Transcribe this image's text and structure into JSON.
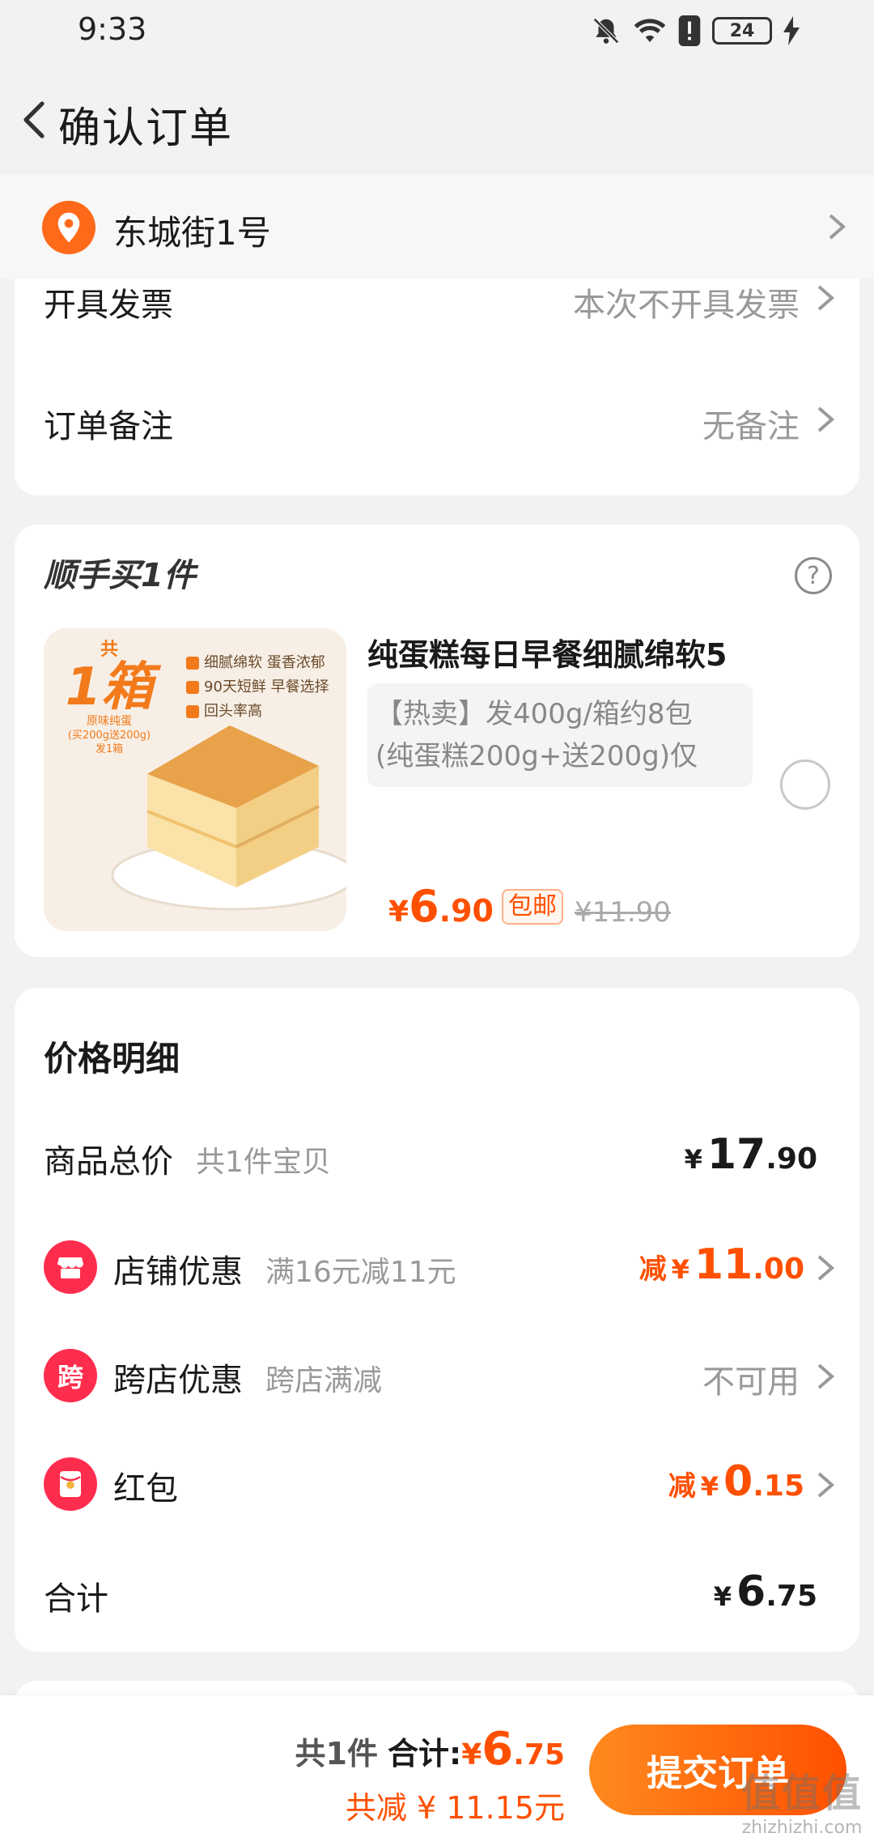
{
  "status_bar": {
    "time": "9:33",
    "battery": "24"
  },
  "header": {
    "title": "确认订单"
  },
  "address": {
    "text": "东城街1号"
  },
  "invoice": {
    "label": "开具发票",
    "value": "本次不开具发票"
  },
  "note": {
    "label": "订单备注",
    "value": "无备注"
  },
  "addon": {
    "section_title": "顺手买1件",
    "help": "?",
    "image": {
      "badge_top": "共",
      "badge_main": "1箱",
      "badge_sub1": "原味纯蛋",
      "badge_sub2": "(买200g送200g)",
      "badge_sub3": "发1箱",
      "features": [
        "细腻绵软 蛋香浓郁",
        "90天短鲜 早餐选择",
        "回头率高"
      ]
    },
    "title": "纯蛋糕每日早餐细腻绵软5",
    "desc_line1": "【热卖】发400g/箱约8包",
    "desc_line2": "(纯蛋糕200g+送200g)仅",
    "price_yen": "¥",
    "price_int": "6",
    "price_dec": ".90",
    "free_shipping": "包邮",
    "old_price": "¥11.90"
  },
  "price_detail": {
    "title": "价格明细",
    "goods_total": {
      "label": "商品总价",
      "sub": "共1件宝贝",
      "yen": "¥",
      "int": "17",
      "dec": ".90"
    },
    "shop_discount": {
      "label": "店铺优惠",
      "sub": "满16元减11元",
      "pre": "减",
      "yen": "¥",
      "int": "11",
      "dec": ".00"
    },
    "cross_discount": {
      "label": "跨店优惠",
      "sub": "跨店满减",
      "icon_text": "跨",
      "value": "不可用"
    },
    "red_packet": {
      "label": "红包",
      "pre": "减",
      "yen": "¥",
      "int": "0",
      "dec": ".15"
    },
    "total": {
      "label": "合计",
      "yen": "¥",
      "int": "6",
      "dec": ".75"
    }
  },
  "bottom": {
    "count": "共1件",
    "total_label": "合计:",
    "yen": "¥",
    "int": "6",
    "dec": ".75",
    "saved": "共减 ¥ 11.15元",
    "submit": "提交订单",
    "watermark": "值值值",
    "watermark_url": "zhizhizhi.com"
  },
  "colors": {
    "accent": "#ff5000",
    "red_icon": "#ff2d4d",
    "pin": "#ff6a1a"
  }
}
